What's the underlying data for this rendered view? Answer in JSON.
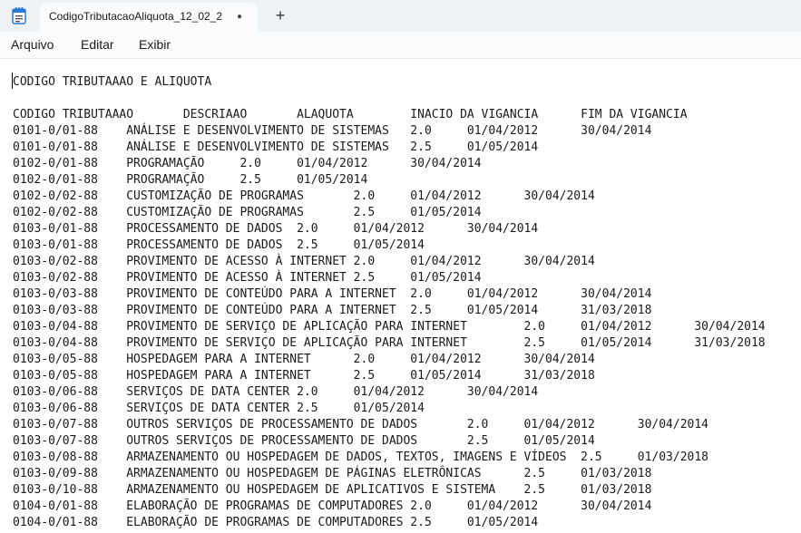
{
  "tab": {
    "title": "CodigoTributacaoAliquota_12_02_2",
    "modified_indicator": "●",
    "new_tab_symbol": "+"
  },
  "menu": {
    "items": [
      "Arquivo",
      "Editar",
      "Exibir"
    ]
  },
  "document": {
    "lines": [
      "CODIGO TRIBUTAAAO E ALIQUOTA",
      "",
      "CODIGO TRIBUTAAAO       DESCRIAAO       ALAQUOTA        INACIO DA VIGANCIA      FIM DA VIGANCIA",
      "0101-0/01-88    ANÁLISE E DESENVOLVIMENTO DE SISTEMAS   2.0     01/04/2012      30/04/2014",
      "0101-0/01-88    ANÁLISE E DESENVOLVIMENTO DE SISTEMAS   2.5     01/05/2014",
      "0102-0/01-88    PROGRAMAÇÃO     2.0     01/04/2012      30/04/2014",
      "0102-0/01-88    PROGRAMAÇÃO     2.5     01/05/2014",
      "0102-0/02-88    CUSTOMIZAÇÃO DE PROGRAMAS       2.0     01/04/2012      30/04/2014",
      "0102-0/02-88    CUSTOMIZAÇÃO DE PROGRAMAS       2.5     01/05/2014",
      "0103-0/01-88    PROCESSAMENTO DE DADOS  2.0     01/04/2012      30/04/2014",
      "0103-0/01-88    PROCESSAMENTO DE DADOS  2.5     01/05/2014",
      "0103-0/02-88    PROVIMENTO DE ACESSO À INTERNET 2.0     01/04/2012      30/04/2014",
      "0103-0/02-88    PROVIMENTO DE ACESSO À INTERNET 2.5     01/05/2014",
      "0103-0/03-88    PROVIMENTO DE CONTEÚDO PARA A INTERNET  2.0     01/04/2012      30/04/2014",
      "0103-0/03-88    PROVIMENTO DE CONTEÚDO PARA A INTERNET  2.5     01/05/2014      31/03/2018",
      "0103-0/04-88    PROVIMENTO DE SERVIÇO DE APLICAÇÃO PARA INTERNET        2.0     01/04/2012      30/04/2014",
      "0103-0/04-88    PROVIMENTO DE SERVIÇO DE APLICAÇÃO PARA INTERNET        2.5     01/05/2014      31/03/2018",
      "0103-0/05-88    HOSPEDAGEM PARA A INTERNET      2.0     01/04/2012      30/04/2014",
      "0103-0/05-88    HOSPEDAGEM PARA A INTERNET      2.5     01/05/2014      31/03/2018",
      "0103-0/06-88    SERVIÇOS DE DATA CENTER 2.0     01/04/2012      30/04/2014",
      "0103-0/06-88    SERVIÇOS DE DATA CENTER 2.5     01/05/2014",
      "0103-0/07-88    OUTROS SERVIÇOS DE PROCESSAMENTO DE DADOS       2.0     01/04/2012      30/04/2014",
      "0103-0/07-88    OUTROS SERVIÇOS DE PROCESSAMENTO DE DADOS       2.5     01/05/2014",
      "0103-0/08-88    ARMAZENAMENTO OU HOSPEDAGEM DE DADOS, TEXTOS, IMAGENS E VÍDEOS  2.5     01/03/2018",
      "0103-0/09-88    ARMAZENAMENTO OU HOSPEDAGEM DE PÁGINAS ELETRÔNICAS      2.5     01/03/2018",
      "0103-0/10-88    ARMAZENAMENTO OU HOSPEDAGEM DE APLICATIVOS E SISTEMA    2.5     01/03/2018",
      "0104-0/01-88    ELABORAÇÃO DE PROGRAMAS DE COMPUTADORES 2.0     01/04/2012      30/04/2014",
      "0104-0/01-88    ELABORAÇÃO DE PROGRAMAS DE COMPUTADORES 2.5     01/05/2014"
    ]
  }
}
